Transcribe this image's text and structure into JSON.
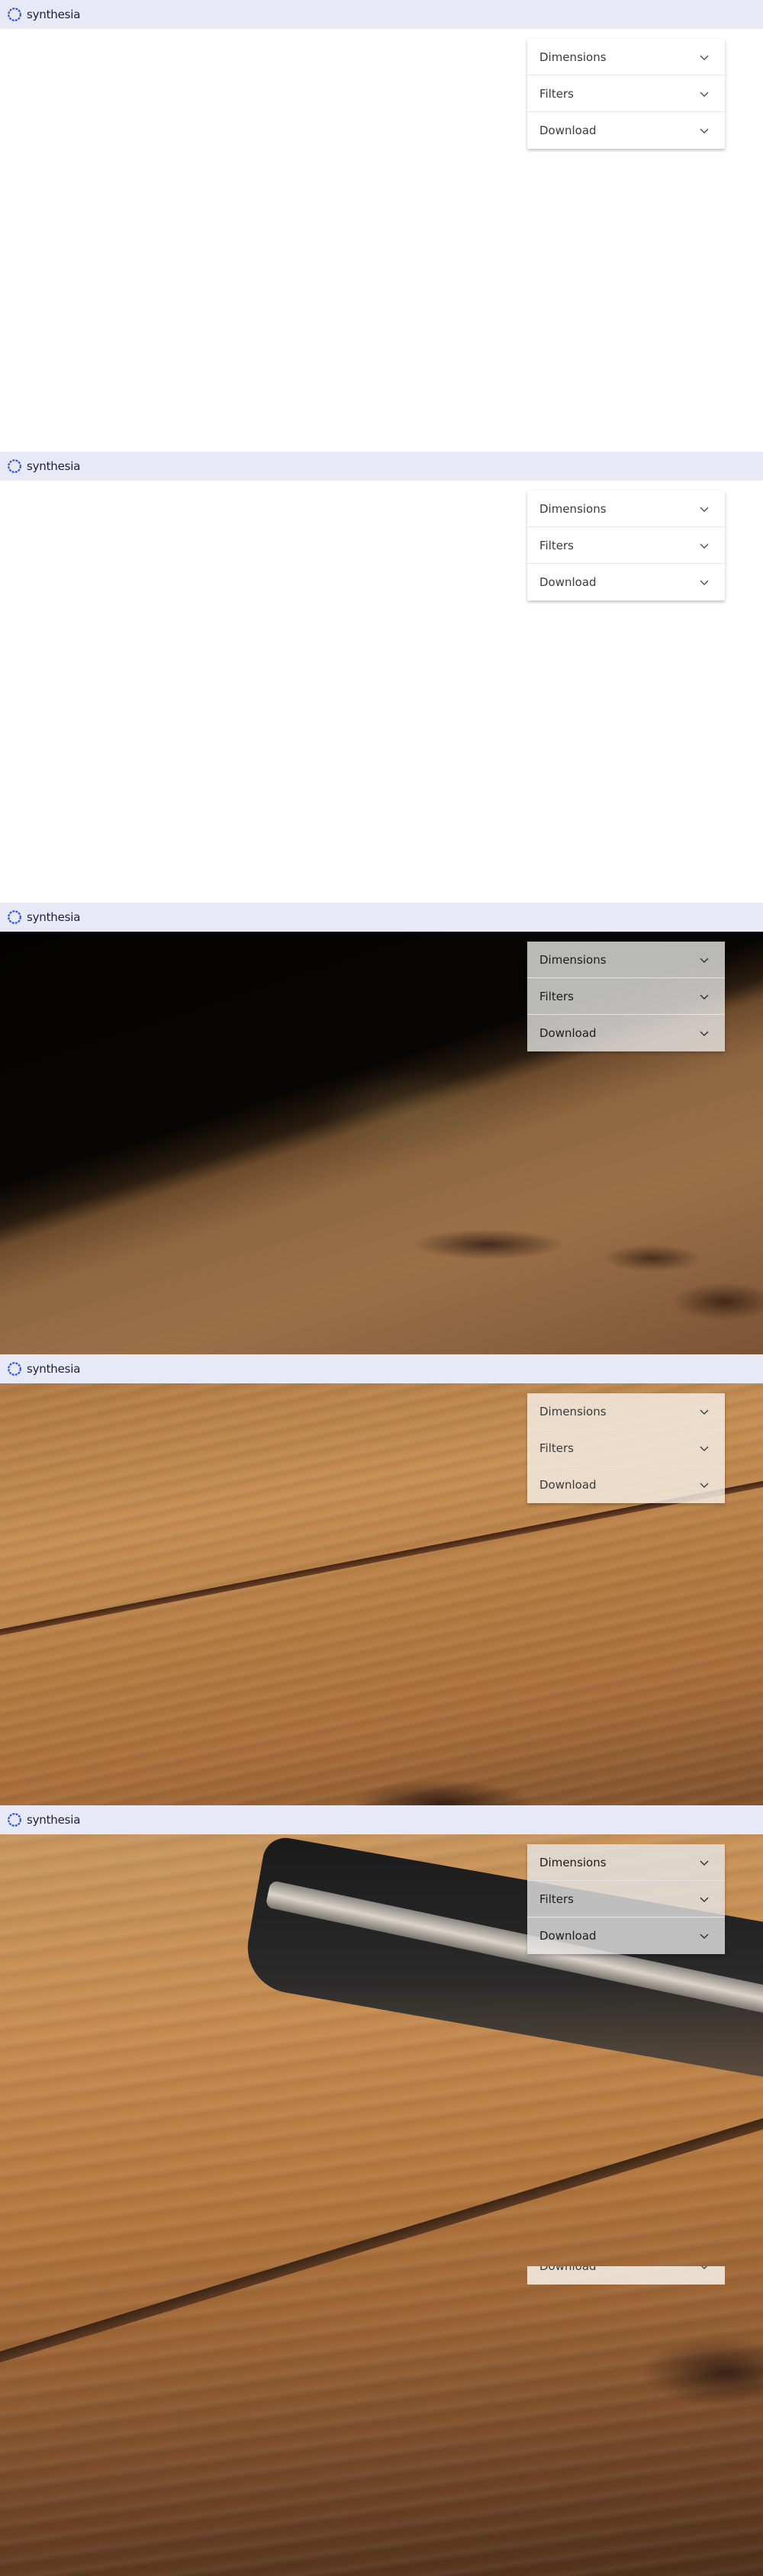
{
  "brand": {
    "name": "synthesia",
    "logo_icon": "synthesia-logo-icon",
    "logo_color": "#2c55e0"
  },
  "topbar_color": "#e7e9f6",
  "panel": {
    "items": [
      {
        "label": "Dimensions",
        "icon": "chevron-down-icon"
      },
      {
        "label": "Filters",
        "icon": "chevron-down-icon"
      },
      {
        "label": "Download",
        "icon": "chevron-down-icon"
      }
    ]
  }
}
